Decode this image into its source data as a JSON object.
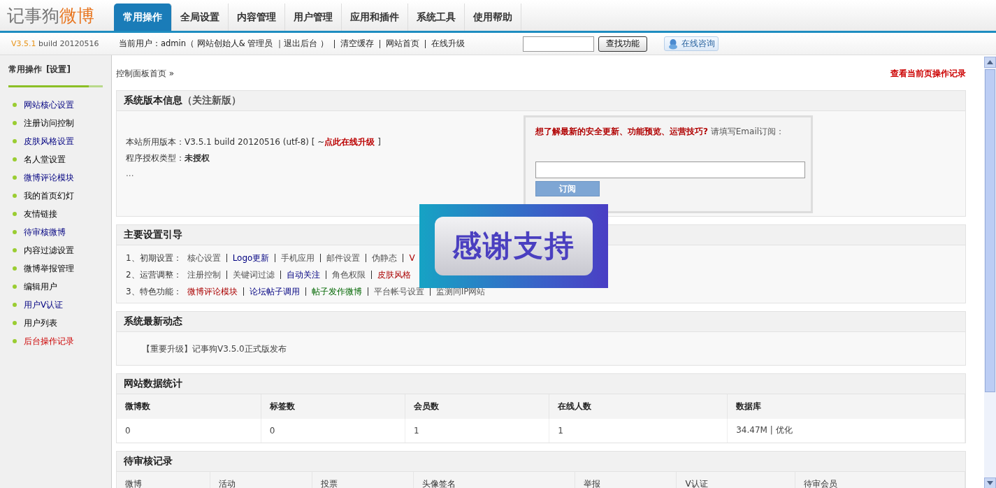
{
  "logo": {
    "main": "记事狗",
    "accent": "微博"
  },
  "tabs": [
    {
      "label": "常用操作",
      "selected": true
    },
    {
      "label": "全局设置",
      "selected": false
    },
    {
      "label": "内容管理",
      "selected": false
    },
    {
      "label": "用户管理",
      "selected": false
    },
    {
      "label": "应用和插件",
      "selected": false
    },
    {
      "label": "系统工具",
      "selected": false
    },
    {
      "label": "使用帮助",
      "selected": false
    }
  ],
  "version": {
    "number": "V3.5.1",
    "build": "build 20120516"
  },
  "user_bar": [
    "当前用户：admin（ 网站创始人& 管理员 ｜退出后台 ）",
    "清空缓存",
    "网站首页",
    "在线升级"
  ],
  "search_button": "查找功能",
  "consult_button": "在线咨询",
  "sidebar": {
    "title": "常用操作",
    "title_link": "[设置]",
    "items": [
      {
        "label": "网站核心设置",
        "kind": "link"
      },
      {
        "label": "注册访问控制",
        "kind": "plain"
      },
      {
        "label": "皮肤风格设置",
        "kind": "link"
      },
      {
        "label": "名人堂设置",
        "kind": "plain"
      },
      {
        "label": "微博评论模块",
        "kind": "link"
      },
      {
        "label": "我的首页幻灯",
        "kind": "plain"
      },
      {
        "label": "友情链接",
        "kind": "plain"
      },
      {
        "label": "待审核微博",
        "kind": "link"
      },
      {
        "label": "内容过滤设置",
        "kind": "plain"
      },
      {
        "label": "微博举报管理",
        "kind": "plain"
      },
      {
        "label": "编辑用户",
        "kind": "plain"
      },
      {
        "label": "用户V认证",
        "kind": "link"
      },
      {
        "label": "用户列表",
        "kind": "plain"
      },
      {
        "label": "后台操作记录",
        "kind": "hot"
      }
    ]
  },
  "breadcrumb": "控制面板首页 »",
  "log_link": "查看当前页操作记录",
  "version_panel": {
    "title": "系统版本信息",
    "title_note": "（关注新版）",
    "version_line": "本站所用版本：V3.5.1  build 20120516 (utf-8)  [ ~",
    "upgrade_link": "点此在线升级",
    "version_end": " ]",
    "license_label": "程序授权类型：",
    "license_value": "未授权",
    "more": "...",
    "subscribe": {
      "prompt": "想了解最新的安全更新、功能预览、运营技巧?",
      "hint": "请填写Email订阅：",
      "button": "订阅"
    }
  },
  "guide_panel": {
    "title": "主要设置引导",
    "rows": [
      {
        "label": "1、初期设置：",
        "links": [
          {
            "text": "核心设置",
            "kind": "plain"
          },
          {
            "text": "Logo更新",
            "kind": "link"
          },
          {
            "text": "手机应用",
            "kind": "plain"
          },
          {
            "text": "邮件设置",
            "kind": "plain"
          },
          {
            "text": "伪静态",
            "kind": "plain"
          },
          {
            "text": "V",
            "kind": "hot"
          }
        ]
      },
      {
        "label": "2、运营调整：",
        "links": [
          {
            "text": "注册控制",
            "kind": "plain"
          },
          {
            "text": "关键词过滤",
            "kind": "plain"
          },
          {
            "text": "自动关注",
            "kind": "link"
          },
          {
            "text": "角色权限",
            "kind": "plain"
          },
          {
            "text": "皮肤风格",
            "kind": "hot"
          }
        ]
      },
      {
        "label": "3、特色功能：",
        "links": [
          {
            "text": "微博评论模块",
            "kind": "hot"
          },
          {
            "text": "论坛帖子调用",
            "kind": "link"
          },
          {
            "text": "帖子发作微博",
            "kind": "green"
          },
          {
            "text": "平台帐号设置",
            "kind": "plain"
          },
          {
            "text": "监测同IP网站",
            "kind": "plain"
          }
        ]
      }
    ]
  },
  "news_panel": {
    "title": "系统最新动态",
    "items": [
      "【重要升级】记事狗V3.5.0正式版发布"
    ]
  },
  "stats_panel": {
    "title": "网站数据统计",
    "columns": [
      "微博数",
      "标签数",
      "会员数",
      "在线人数",
      "数据库"
    ],
    "rows": [
      [
        "0",
        "0",
        "1",
        "1",
        "34.47M | 优化"
      ]
    ]
  },
  "pending_panel": {
    "title": "待审核记录",
    "columns": [
      "微博",
      "活动",
      "投票",
      "头像签名",
      "举报",
      "V认证",
      "待审会员"
    ]
  },
  "overlay": {
    "text": "感谢支持"
  }
}
